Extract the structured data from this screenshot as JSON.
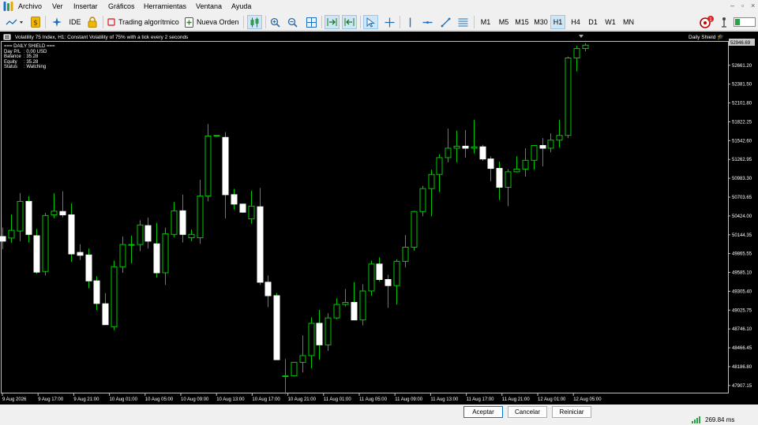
{
  "menu": {
    "items": [
      "Archivo",
      "Ver",
      "Insertar",
      "Gráficos",
      "Herramientas",
      "Ventana",
      "Ayuda"
    ]
  },
  "toolbar": {
    "ide_label": "IDE",
    "algo_label": "Trading algorítmico",
    "new_order_label": "Nueva Orden",
    "timeframes": [
      "M1",
      "M5",
      "M15",
      "M30",
      "H1",
      "H4",
      "D1",
      "W1",
      "MN"
    ],
    "active_timeframe": "H1",
    "notification_count": "1"
  },
  "chart": {
    "header": "Volatility 75 Index, H1: Constant Volatility of 75% with a tick every 2 seconds",
    "indicator_tag": "Daily Shield",
    "current_price": "52946.69",
    "panel": {
      "title": "=== DAILY SHIELD ===",
      "rows": [
        {
          "label": "Day P/L",
          "value": ": 0.00 USD"
        },
        {
          "label": "Balance",
          "value": ": 35.28"
        },
        {
          "label": "Equity",
          "value": ": 35.28"
        },
        {
          "label": "Status",
          "value": ": Watching"
        }
      ]
    }
  },
  "chart_data": {
    "type": "candlestick",
    "y_ticks": [
      "52661.20",
      "52381.50",
      "52101.80",
      "51822.25",
      "51542.60",
      "51262.95",
      "50983.30",
      "50703.65",
      "50424.00",
      "50144.35",
      "49865.55",
      "49585.10",
      "49305.40",
      "49025.75",
      "48746.10",
      "48466.45",
      "48186.80",
      "47907.15"
    ],
    "ylim": [
      47800,
      53010
    ],
    "x_ticks": [
      "9 Aug 2026",
      "9 Aug 17:00",
      "9 Aug 21:00",
      "10 Aug 01:00",
      "10 Aug 05:00",
      "10 Aug 09:00",
      "10 Aug 13:00",
      "10 Aug 17:00",
      "10 Aug 21:00",
      "11 Aug 01:00",
      "11 Aug 05:00",
      "11 Aug 09:00",
      "11 Aug 13:00",
      "11 Aug 17:00",
      "11 Aug 21:00",
      "12 Aug 01:00",
      "12 Aug 05:00"
    ],
    "bull_color": "#00c800",
    "bear_color": "#ffffff",
    "candles": [
      {
        "o": 50118,
        "h": 50252,
        "l": 49932,
        "c": 50050
      },
      {
        "o": 50096,
        "h": 50448,
        "l": 50028,
        "c": 50210
      },
      {
        "o": 50200,
        "h": 50765,
        "l": 50050,
        "c": 50640
      },
      {
        "o": 50640,
        "h": 50720,
        "l": 50030,
        "c": 50150
      },
      {
        "o": 50130,
        "h": 50232,
        "l": 49566,
        "c": 49590
      },
      {
        "o": 49600,
        "h": 50470,
        "l": 49540,
        "c": 50430
      },
      {
        "o": 50440,
        "h": 50760,
        "l": 50390,
        "c": 50495
      },
      {
        "o": 50490,
        "h": 50790,
        "l": 50402,
        "c": 50440
      },
      {
        "o": 50440,
        "h": 50610,
        "l": 49740,
        "c": 49860
      },
      {
        "o": 49882,
        "h": 50004,
        "l": 49770,
        "c": 49840
      },
      {
        "o": 49845,
        "h": 49940,
        "l": 49350,
        "c": 49460
      },
      {
        "o": 49460,
        "h": 49530,
        "l": 49030,
        "c": 49125
      },
      {
        "o": 49120,
        "h": 49280,
        "l": 48810,
        "c": 48810
      },
      {
        "o": 48780,
        "h": 49760,
        "l": 48730,
        "c": 49670
      },
      {
        "o": 49670,
        "h": 50120,
        "l": 49580,
        "c": 50000
      },
      {
        "o": 50000,
        "h": 50130,
        "l": 49720,
        "c": 50000
      },
      {
        "o": 50000,
        "h": 50360,
        "l": 49900,
        "c": 50290
      },
      {
        "o": 50280,
        "h": 50400,
        "l": 49940,
        "c": 50050
      },
      {
        "o": 50010,
        "h": 50320,
        "l": 49510,
        "c": 49580
      },
      {
        "o": 49580,
        "h": 50250,
        "l": 49400,
        "c": 50160
      },
      {
        "o": 50150,
        "h": 50630,
        "l": 50110,
        "c": 50500
      },
      {
        "o": 50500,
        "h": 50740,
        "l": 50030,
        "c": 50150
      },
      {
        "o": 50100,
        "h": 50220,
        "l": 50050,
        "c": 50150
      },
      {
        "o": 50100,
        "h": 50960,
        "l": 50010,
        "c": 50720
      },
      {
        "o": 50720,
        "h": 51790,
        "l": 50640,
        "c": 51610
      },
      {
        "o": 51610,
        "h": 51620,
        "l": 51610,
        "c": 51620
      },
      {
        "o": 51590,
        "h": 51670,
        "l": 50390,
        "c": 50740
      },
      {
        "o": 50740,
        "h": 50826,
        "l": 50520,
        "c": 50600
      },
      {
        "o": 50600,
        "h": 50600,
        "l": 50470,
        "c": 50480
      },
      {
        "o": 50380,
        "h": 50800,
        "l": 50310,
        "c": 50570
      },
      {
        "o": 50560,
        "h": 50840,
        "l": 49400,
        "c": 49440
      },
      {
        "o": 49440,
        "h": 49540,
        "l": 49070,
        "c": 49240
      },
      {
        "o": 49240,
        "h": 49280,
        "l": 48290,
        "c": 48290
      },
      {
        "o": 48050,
        "h": 48300,
        "l": 47780,
        "c": 48050
      },
      {
        "o": 48050,
        "h": 48200,
        "l": 48040,
        "c": 48250
      },
      {
        "o": 48250,
        "h": 48650,
        "l": 48100,
        "c": 48350
      },
      {
        "o": 48350,
        "h": 48920,
        "l": 48160,
        "c": 48830
      },
      {
        "o": 48830,
        "h": 49030,
        "l": 48290,
        "c": 48510
      },
      {
        "o": 48510,
        "h": 48980,
        "l": 48420,
        "c": 48910
      },
      {
        "o": 48910,
        "h": 49200,
        "l": 48890,
        "c": 49110
      },
      {
        "o": 49110,
        "h": 49340,
        "l": 49080,
        "c": 49140
      },
      {
        "o": 49140,
        "h": 49440,
        "l": 49000,
        "c": 48880
      },
      {
        "o": 48880,
        "h": 49410,
        "l": 48800,
        "c": 49310
      },
      {
        "o": 49310,
        "h": 49760,
        "l": 49240,
        "c": 49710
      },
      {
        "o": 49710,
        "h": 49810,
        "l": 49450,
        "c": 49480
      },
      {
        "o": 49480,
        "h": 49550,
        "l": 49060,
        "c": 49390
      },
      {
        "o": 49390,
        "h": 49780,
        "l": 49110,
        "c": 49750
      },
      {
        "o": 49750,
        "h": 50140,
        "l": 49660,
        "c": 49960
      },
      {
        "o": 49960,
        "h": 50500,
        "l": 49910,
        "c": 50490
      },
      {
        "o": 50490,
        "h": 50870,
        "l": 50420,
        "c": 50830
      },
      {
        "o": 50830,
        "h": 51110,
        "l": 50420,
        "c": 51040
      },
      {
        "o": 51040,
        "h": 51340,
        "l": 50780,
        "c": 51290
      },
      {
        "o": 51290,
        "h": 51720,
        "l": 51220,
        "c": 51430
      },
      {
        "o": 51430,
        "h": 51690,
        "l": 51220,
        "c": 51460
      },
      {
        "o": 51460,
        "h": 51700,
        "l": 51290,
        "c": 51430
      },
      {
        "o": 51430,
        "h": 51850,
        "l": 51350,
        "c": 51450
      },
      {
        "o": 51450,
        "h": 51480,
        "l": 51240,
        "c": 51270
      },
      {
        "o": 51270,
        "h": 51310,
        "l": 50940,
        "c": 51130
      },
      {
        "o": 51130,
        "h": 51230,
        "l": 50660,
        "c": 50850
      },
      {
        "o": 50850,
        "h": 51120,
        "l": 50570,
        "c": 51080
      },
      {
        "o": 51080,
        "h": 51310,
        "l": 51070,
        "c": 51120
      },
      {
        "o": 51120,
        "h": 51430,
        "l": 51010,
        "c": 51250
      },
      {
        "o": 51250,
        "h": 51460,
        "l": 51110,
        "c": 51470
      },
      {
        "o": 51470,
        "h": 51580,
        "l": 51160,
        "c": 51430
      },
      {
        "o": 51430,
        "h": 51650,
        "l": 51370,
        "c": 51550
      },
      {
        "o": 51550,
        "h": 51850,
        "l": 51440,
        "c": 51620
      },
      {
        "o": 51620,
        "h": 52790,
        "l": 51580,
        "c": 52770
      },
      {
        "o": 52770,
        "h": 52950,
        "l": 52570,
        "c": 52910
      },
      {
        "o": 52910,
        "h": 52990,
        "l": 52870,
        "c": 52960
      }
    ]
  },
  "actions": {
    "accept_label": "Aceptar",
    "cancel_label": "Cancelar",
    "reset_label": "Reiniciar"
  },
  "status": {
    "ping": "269.84 ms"
  }
}
